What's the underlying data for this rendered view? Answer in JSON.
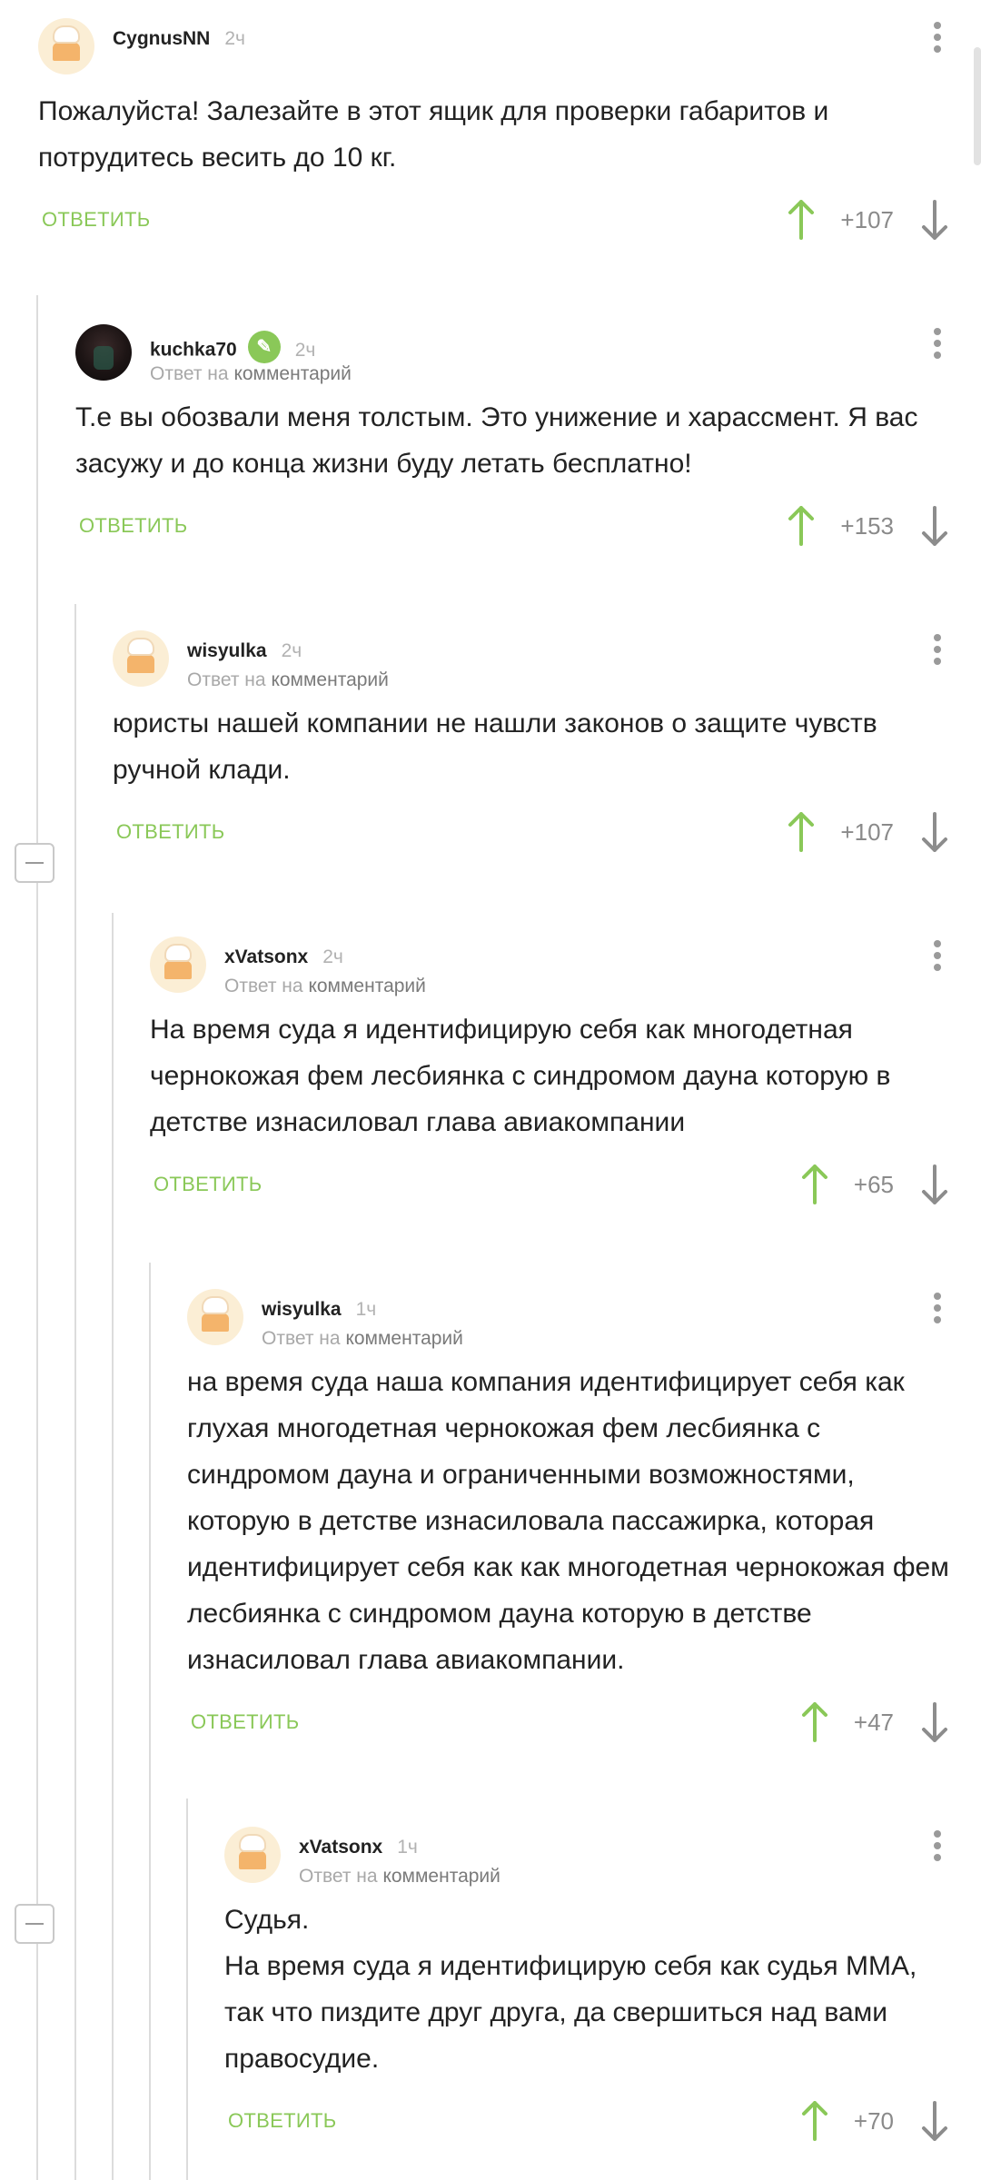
{
  "reply_label": "ОТВЕТИТЬ",
  "reply_to_prefix": "Ответ на",
  "reply_to_link": "комментарий",
  "colors": {
    "accent": "#8ac858",
    "text": "#222222",
    "muted": "#a8a8a8"
  },
  "icons": {
    "upvote": "arrow-up-icon",
    "downvote": "arrow-down-icon",
    "more": "more-vertical-icon",
    "collapse": "minus-icon",
    "moderator": "pencil-icon"
  },
  "comments": [
    {
      "user": "CygnusNN",
      "time": "2ч",
      "text": "Пожалуйста! Залезайте в этот ящик для проверки габаритов и потрудитесь весить до 10 кг.",
      "rating": "+107"
    },
    {
      "user": "kuchka70",
      "time": "2ч",
      "text": "Т.е вы обозвали меня толстым. Это унижение и харассмент. Я вас засужу и до конца жизни буду летать бесплатно!",
      "rating": "+153"
    },
    {
      "user": "wisyulka",
      "time": "2ч",
      "text": "юристы нашей компании не нашли законов о защите чувств ручной клади.",
      "rating": "+107"
    },
    {
      "user": "xVatsonx",
      "time": "2ч",
      "text": "На время суда я идентифицирую себя как многодетная чернокожая фем лесбиянка с синдромом дауна которую в детстве изнасиловал глава авиакомпании",
      "rating": "+65"
    },
    {
      "user": "wisyulka",
      "time": "1ч",
      "text": "на время суда наша компания идентифицирует себя как глухая многодетная чернокожая фем лесбиянка с синдромом дауна и ограниченными возможностями, которую в детстве изнасиловала пассажирка, которая идентифицирует себя как как многодетная чернокожая фем лесбиянка с синдромом дауна которую в детстве изнасиловал глава авиакомпании.",
      "rating": "+47"
    },
    {
      "user": "xVatsonx",
      "time": "1ч",
      "text": "Судья.\nНа время суда я идентифицирую себя как судья ММА, так что пиздите друг друга, да свершиться над вами правосудие.",
      "rating": "+70"
    }
  ]
}
